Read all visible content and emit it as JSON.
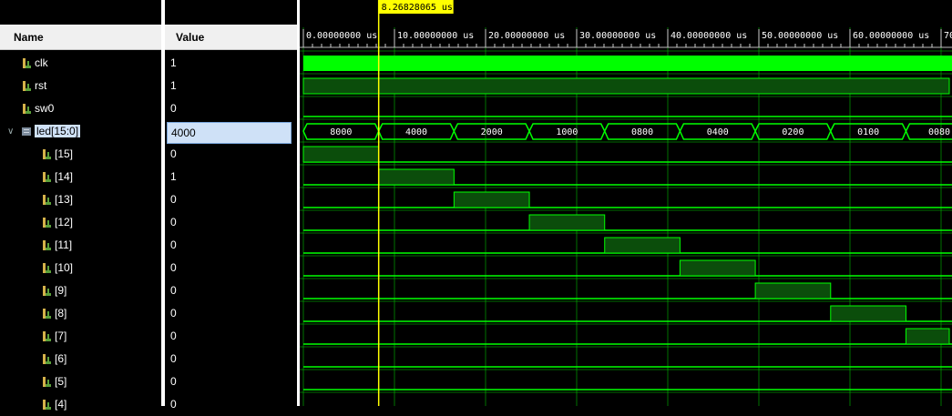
{
  "columns": {
    "name": "Name",
    "value": "Value"
  },
  "cursor": {
    "label": "8.26828065 us",
    "time_us": 8.26828065
  },
  "time_axis": {
    "unit": "us",
    "labels": [
      "0.00000000 us",
      "10.00000000 us",
      "20.00000000 us",
      "30.00000000 us",
      "40.00000000 us",
      "50.00000000 us",
      "60.00000000 us",
      "70"
    ]
  },
  "signals": [
    {
      "name": "clk",
      "value": "1",
      "type": "bit"
    },
    {
      "name": "rst",
      "value": "1",
      "type": "bit"
    },
    {
      "name": "sw0",
      "value": "0",
      "type": "bit"
    },
    {
      "name": "led[15:0]",
      "value": "4000",
      "type": "bus",
      "expanded": true,
      "selected": true
    },
    {
      "name": "[15]",
      "value": "0",
      "type": "bit",
      "child": true
    },
    {
      "name": "[14]",
      "value": "1",
      "type": "bit",
      "child": true
    },
    {
      "name": "[13]",
      "value": "0",
      "type": "bit",
      "child": true
    },
    {
      "name": "[12]",
      "value": "0",
      "type": "bit",
      "child": true
    },
    {
      "name": "[11]",
      "value": "0",
      "type": "bit",
      "child": true
    },
    {
      "name": "[10]",
      "value": "0",
      "type": "bit",
      "child": true
    },
    {
      "name": "[9]",
      "value": "0",
      "type": "bit",
      "child": true
    },
    {
      "name": "[8]",
      "value": "0",
      "type": "bit",
      "child": true
    },
    {
      "name": "[7]",
      "value": "0",
      "type": "bit",
      "child": true
    },
    {
      "name": "[6]",
      "value": "0",
      "type": "bit",
      "child": true
    },
    {
      "name": "[5]",
      "value": "0",
      "type": "bit",
      "child": true
    },
    {
      "name": "[4]",
      "value": "0",
      "type": "bit",
      "child": true
    }
  ],
  "bus_values": [
    "8000",
    "4000",
    "2000",
    "1000",
    "0800",
    "0400",
    "0200",
    "0100",
    "0080"
  ],
  "bus_segment_us": 8.26828065,
  "colors": {
    "wave": "#00ff00",
    "wave_fill": "#0b4d0b",
    "cursor": "#ffff00",
    "grid": "#00c000"
  }
}
